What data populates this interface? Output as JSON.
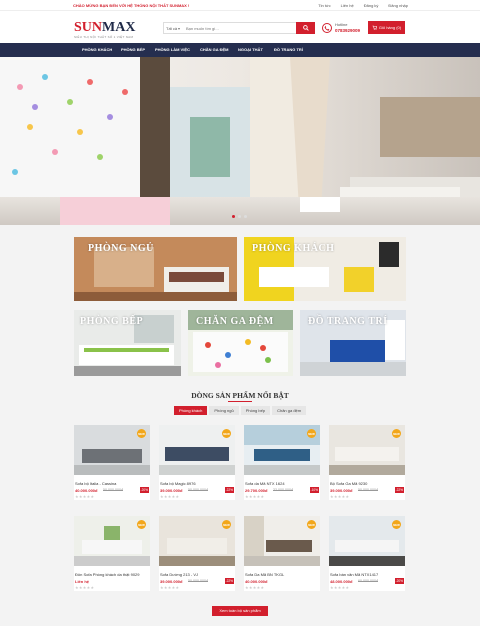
{
  "topbar": {
    "welcome": "CHÀO MỪNG BẠN ĐẾN VỚI HỆ THỐNG NỘI THẤT SUNMAX !",
    "links": [
      "Tin tức",
      "Liên hệ",
      "Đăng ký",
      "Đăng nhập"
    ]
  },
  "header": {
    "logo_prefix": "SUN",
    "logo_suffix": "MAX",
    "logo_tagline": "SIÊU THỊ NỘI THẤT SỐ 1 VIỆT NAM",
    "search_category": "Tất cả",
    "search_placeholder": "Bạn muốn tìm gì...",
    "hotline_label": "Hotline",
    "hotline_number": "0783929009",
    "cart_label": "Giỏ hàng (0)"
  },
  "nav": [
    "PHÒNG KHÁCH",
    "PHÒNG BẾP",
    "PHÒNG LÀM VIỆC",
    "CHĂN GA ĐỆM",
    "NGOẠI THẤT",
    "ĐỒ TRANG TRÍ"
  ],
  "categories": [
    "PHÒNG NGỦ",
    "PHÒNG KHÁCH",
    "PHÒNG BẾP",
    "CHĂN GA ĐỆM",
    "ĐỒ TRANG TRÍ"
  ],
  "products_section": {
    "title": "DÒNG SẢN PHẨM NỔI BẬT",
    "tabs": [
      "Phòng khách",
      "Phòng ngủ",
      "Phòng bếp",
      "Chăn ga đệm"
    ],
    "new_badge": "NEW",
    "products": [
      {
        "name": "Sofa bộ Italia - Cassina",
        "price": "40.000.000đ",
        "old": "50.000.000đ",
        "discount": "-20%"
      },
      {
        "name": "Sofa bộ Magic 8976",
        "price": "39.000.000đ",
        "old": "50.000.000đ",
        "discount": "-22%"
      },
      {
        "name": "Sofa da Mã NTX 1624",
        "price": "29.700.000đ",
        "old": "33.000.000đ",
        "discount": "-10%"
      },
      {
        "name": "Bộ Sofa Ga Mã 9230",
        "price": "39.000.000đ",
        "old": "50.000.000đ",
        "discount": "-22%"
      },
      {
        "name": "Đôn Sofa Phòng khách da thật 9029",
        "price": "Liên hệ",
        "old": "",
        "discount": ""
      },
      {
        "name": "Sofa Dường 213 - VJ",
        "price": "39.000.000đ",
        "old": "50.000.000đ",
        "discount": "-22%"
      },
      {
        "name": "Sofa Da Mã BN TKGL",
        "price": "40.000.000đ",
        "old": "",
        "discount": ""
      },
      {
        "name": "Sofa bàn văn Mã NTX1417",
        "price": "48.000.000đ",
        "old": "60.000.000đ",
        "discount": "-20%"
      }
    ],
    "more_button": "Xem toàn bộ sản phẩm"
  },
  "colors": {
    "accent": "#d21f2d",
    "nav": "#252e4f",
    "badge": "#f2a71b"
  }
}
